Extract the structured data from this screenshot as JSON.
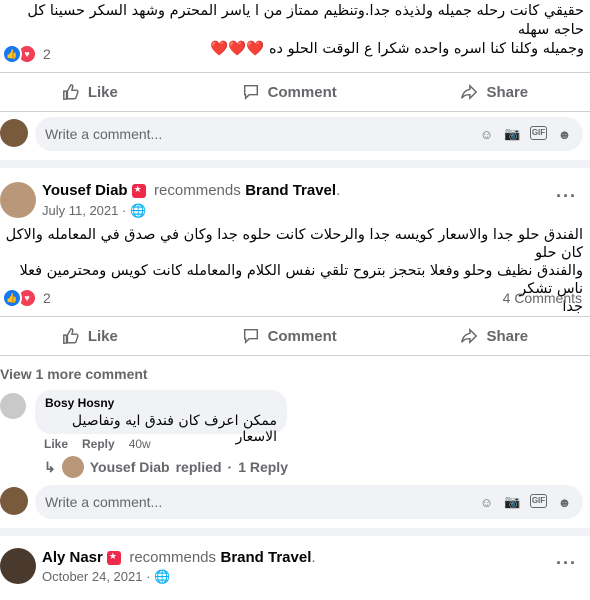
{
  "post1": {
    "text_line1": "حقيقي كانت رحله جميله ولذيذه جدا.وتنظيم ممتاز من ا ياسر المحترم وشهد السكر حسينا كل حاجه سهله",
    "text_line2": "وجميله وكلنا كنا اسره واحده شكرا ع الوقت الحلو ده ❤️❤️❤️",
    "reaction_count": "2"
  },
  "actions": {
    "like": "Like",
    "comment": "Comment",
    "share": "Share"
  },
  "comment_placeholder": "Write a comment...",
  "post2": {
    "author": "Yousef Diab",
    "recommends": "recommends",
    "page": "Brand Travel",
    "date": "July 11, 2021",
    "text_line1": "الفندق حلو جدا والاسعار كويسه جدا والرحلات كانت حلوه جدا وكان في صدق في المعامله والاكل كان حلو",
    "text_line2": "والفندق نظيف وحلو وفعلا بتحجز بتروح تلقي نفس الكلام والمعامله كانت كويس ومحترمين فعلا ناس تشكر",
    "text_line3": "جدا",
    "reaction_count": "2",
    "comments_count": "4 Comments",
    "view_more": "View 1 more comment",
    "comment": {
      "author": "Bosy Hosny",
      "text": "ممكن اعرف كان فندق ايه وتفاصيل الاسعار",
      "like": "Like",
      "reply": "Reply",
      "time": "40w"
    },
    "reply_summary": {
      "author": "Yousef Diab",
      "replied": "replied",
      "separator": "·",
      "count": "1 Reply"
    }
  },
  "post3": {
    "author": "Aly Nasr",
    "recommends": "recommends",
    "page": "Brand Travel",
    "date": "October 24, 2021"
  }
}
